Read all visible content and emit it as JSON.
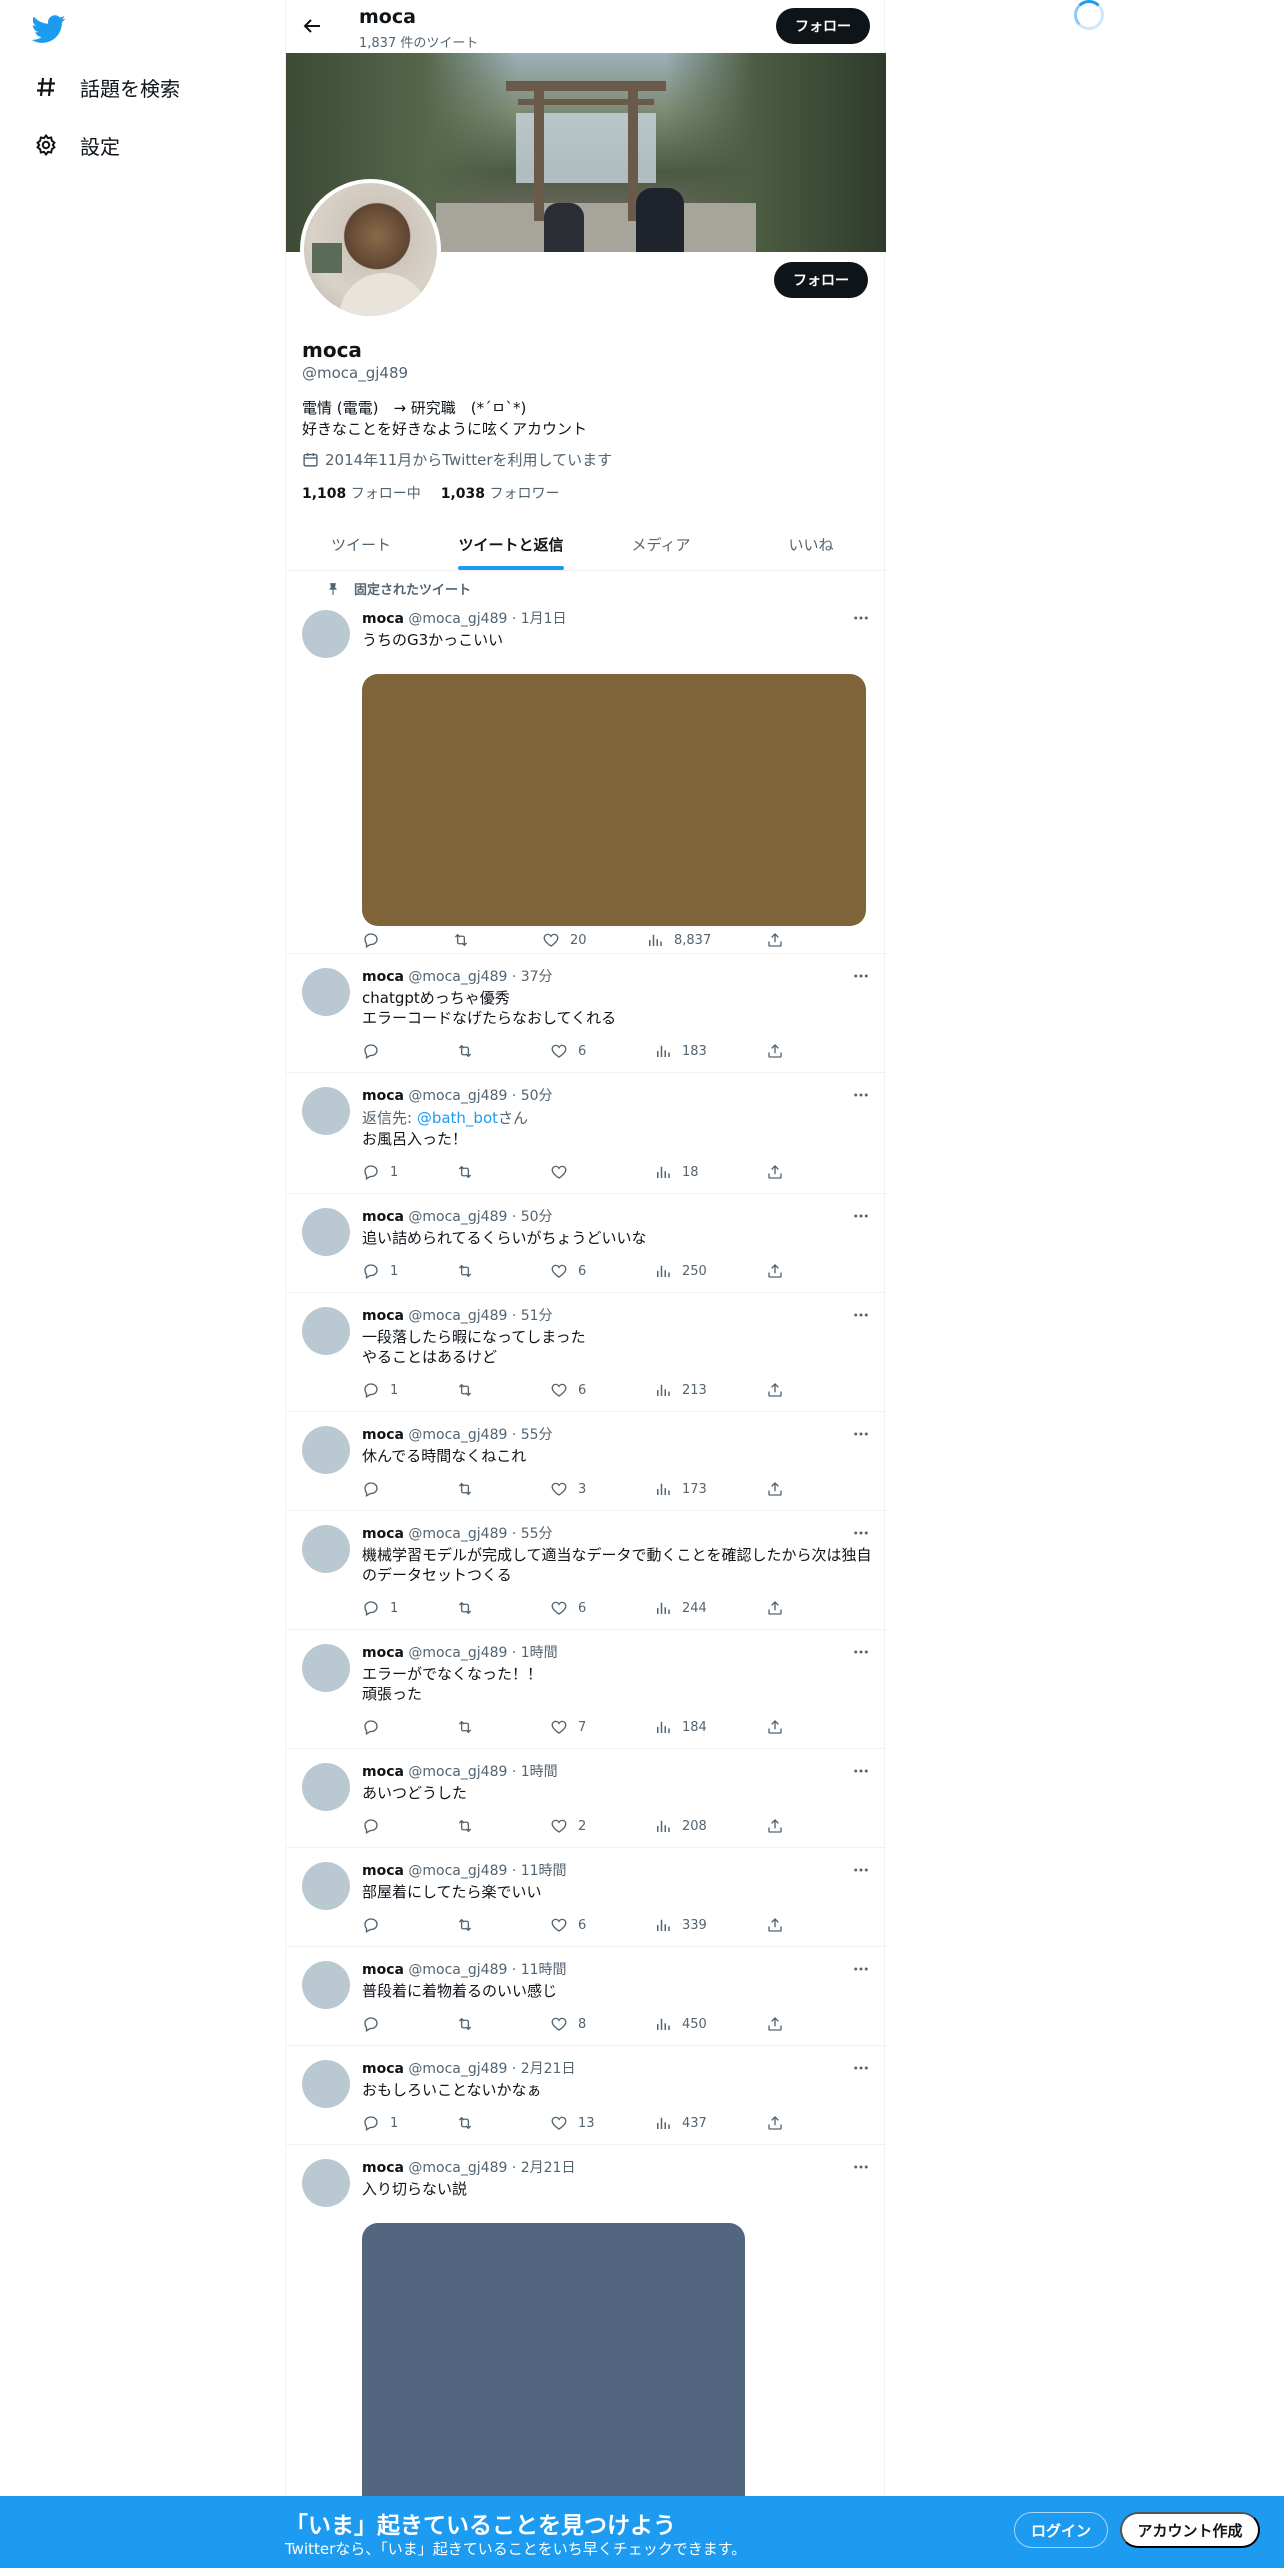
{
  "sidebar": {
    "items": [
      {
        "label": "話題を検索",
        "icon": "hashtag-icon"
      },
      {
        "label": "設定",
        "icon": "gear-icon"
      }
    ]
  },
  "header": {
    "name": "moca",
    "tweet_count": "1,837 件のツイート",
    "follow_label": "フォロー"
  },
  "profile": {
    "name": "moca",
    "handle": "@moca_gj489",
    "bio": "電情 (電電)　→ 研究職　(*´ㅁ`*)\n好きなことを好きなように呟くアカウント",
    "joined": "2014年11月からTwitterを利用しています",
    "following_count": "1,108",
    "following_label": "フォロー中",
    "followers_count": "1,038",
    "followers_label": "フォロワー",
    "follow_label": "フォロー"
  },
  "tabs": [
    {
      "label": "ツイート",
      "active": false
    },
    {
      "label": "ツイートと返信",
      "active": true
    },
    {
      "label": "メディア",
      "active": false
    },
    {
      "label": "いいね",
      "active": false
    }
  ],
  "pinned_label": "固定されたツイート",
  "tweets": [
    {
      "name": "moca",
      "meta": "@moca_gj489 · 1月1日",
      "text": "うちのG3かっこいい",
      "reply": "",
      "replies": "",
      "likes": "20",
      "views": "8,837",
      "media_color": "#7f643a"
    },
    {
      "name": "moca",
      "meta": "@moca_gj489 · 37分",
      "text": "chatgptめっちゃ優秀\nエラーコードなげたらなおしてくれる",
      "reply": "",
      "replies": "",
      "likes": "6",
      "views": "183"
    },
    {
      "name": "moca",
      "meta": "@moca_gj489 · 50分",
      "text": "お風呂入った！",
      "reply_prefix": "返信先: ",
      "reply_user": "@bath_bot",
      "reply_suffix": "さん",
      "replies": "1",
      "likes": "",
      "views": "18"
    },
    {
      "name": "moca",
      "meta": "@moca_gj489 · 50分",
      "text": "追い詰められてるくらいがちょうどいいな",
      "reply": "",
      "replies": "1",
      "likes": "6",
      "views": "250"
    },
    {
      "name": "moca",
      "meta": "@moca_gj489 · 51分",
      "text": "一段落したら暇になってしまった\nやることはあるけど",
      "reply": "",
      "replies": "1",
      "likes": "6",
      "views": "213"
    },
    {
      "name": "moca",
      "meta": "@moca_gj489 · 55分",
      "text": "休んでる時間なくねこれ",
      "reply": "",
      "replies": "",
      "likes": "3",
      "views": "173"
    },
    {
      "name": "moca",
      "meta": "@moca_gj489 · 55分",
      "text": "機械学習モデルが完成して適当なデータで動くことを確認したから次は独自のデータセットつくる",
      "reply": "",
      "replies": "1",
      "likes": "6",
      "views": "244"
    },
    {
      "name": "moca",
      "meta": "@moca_gj489 · 1時間",
      "text": "エラーがでなくなった！！\n頑張った",
      "reply": "",
      "replies": "",
      "likes": "7",
      "views": "184"
    },
    {
      "name": "moca",
      "meta": "@moca_gj489 · 1時間",
      "text": "あいつどうした",
      "reply": "",
      "replies": "",
      "likes": "2",
      "views": "208"
    },
    {
      "name": "moca",
      "meta": "@moca_gj489 · 11時間",
      "text": "部屋着にしてたら楽でいい",
      "reply": "",
      "replies": "",
      "likes": "6",
      "views": "339"
    },
    {
      "name": "moca",
      "meta": "@moca_gj489 · 11時間",
      "text": "普段着に着物着るのいい感じ",
      "reply": "",
      "replies": "",
      "likes": "8",
      "views": "450"
    },
    {
      "name": "moca",
      "meta": "@moca_gj489 · 2月21日",
      "text": "おもしろいことないかなぁ",
      "reply": "",
      "replies": "1",
      "likes": "13",
      "views": "437"
    },
    {
      "name": "moca",
      "meta": "@moca_gj489 · 2月21日",
      "text": "入り切らない説",
      "reply": "",
      "media_color": "#52667f"
    }
  ],
  "bottom_bar": {
    "title": "「いま」起きていることを見つけよう",
    "subtitle": "Twitterなら、「いま」起きていることをいち早くチェックできます。",
    "login_label": "ログイン",
    "signup_label": "アカウント作成"
  },
  "colors": {
    "accent": "#1d9bf0",
    "text": "#0f1419",
    "muted": "#536471"
  }
}
